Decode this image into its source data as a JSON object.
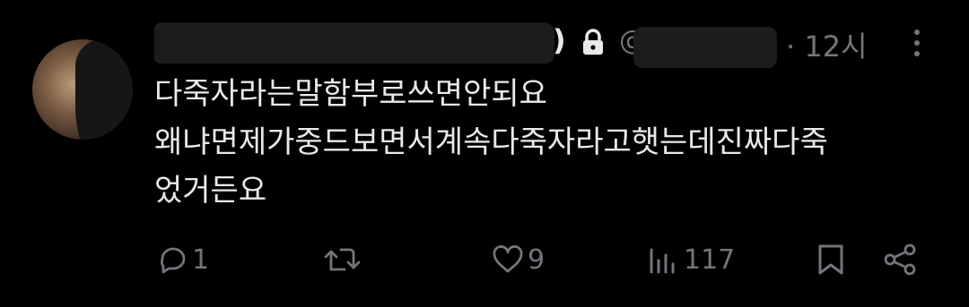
{
  "header": {
    "name_suffix": ")",
    "at": "@",
    "time": "· 12시"
  },
  "body": {
    "lines": [
      "다죽자라는말함부로쓰면안되요",
      "왜냐면제가중드보면서계속다죽자라고햇는데진짜다죽",
      "었거든요"
    ]
  },
  "actions": {
    "reply_count": "1",
    "retweet_count": "",
    "like_count": "9",
    "view_count": "117"
  },
  "icons": {
    "lock": "lock-icon",
    "more": "more-vertical-icon",
    "reply": "reply-icon",
    "retweet": "retweet-icon",
    "like": "heart-icon",
    "views": "views-chart-icon",
    "bookmark": "bookmark-icon",
    "share": "share-icon"
  },
  "colors": {
    "background": "#000000",
    "text": "#e7e9ea",
    "muted": "#71767b",
    "redaction": "#1c1c1c"
  }
}
